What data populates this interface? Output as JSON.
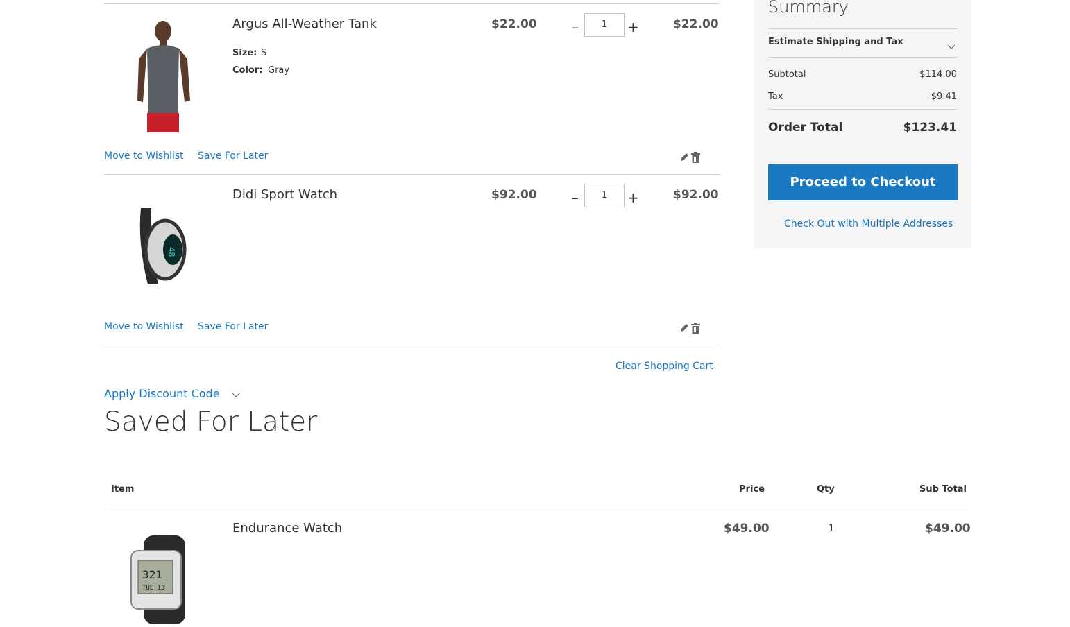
{
  "cart": {
    "items": [
      {
        "name": "Argus All-Weather Tank",
        "price": "$22.00",
        "qty": "1",
        "subtotal": "$22.00",
        "options": [
          {
            "label": "Size:",
            "value": "S"
          },
          {
            "label": "Color:",
            "value": "Gray"
          }
        ],
        "move_to_wishlist": "Move to Wishlist",
        "save_for_later": "Save For Later"
      },
      {
        "name": "Didi Sport Watch",
        "price": "$92.00",
        "qty": "1",
        "subtotal": "$92.00",
        "move_to_wishlist": "Move to Wishlist",
        "save_for_later": "Save For Later"
      }
    ],
    "clear_cart": "Clear Shopping Cart",
    "apply_discount": "Apply Discount Code"
  },
  "summary": {
    "title": "Summary",
    "estimate_shipping": "Estimate Shipping and Tax",
    "subtotal_label": "Subtotal",
    "subtotal_value": "$114.00",
    "tax_label": "Tax",
    "tax_value": "$9.41",
    "order_total_label": "Order Total",
    "order_total_value": "$123.41",
    "checkout_button": "Proceed to Checkout",
    "multi_address": "Check Out with Multiple Addresses"
  },
  "saved_for_later": {
    "title": "Saved For Later",
    "headers": {
      "item": "Item",
      "price": "Price",
      "qty": "Qty",
      "subtotal": "Sub Total"
    },
    "items": [
      {
        "name": "Endurance Watch",
        "price": "$49.00",
        "qty": "1",
        "subtotal": "$49.00"
      }
    ]
  }
}
